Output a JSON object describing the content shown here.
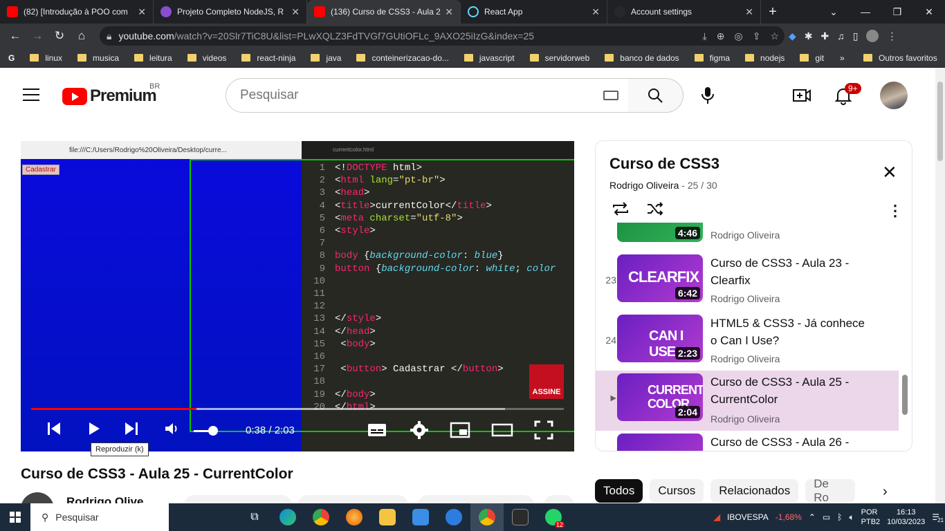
{
  "browser": {
    "tabs": [
      {
        "title": "(82) [Introdução à POO com",
        "icon_color": "#ff0000"
      },
      {
        "title": "Projeto Completo NodeJS, R",
        "icon_color": "#8a4dd0"
      },
      {
        "title": "(136) Curso de CSS3 - Aula 2",
        "icon_color": "#ff0000"
      },
      {
        "title": "React App",
        "icon_color": "#61dafb"
      },
      {
        "title": "Account settings",
        "icon_color": "#24292f"
      }
    ],
    "url_host": "youtube.com",
    "url_path": "/watch?v=20Slr7TiC8U&list=PLwXQLZ3FdTVGf7GUtiOFLc_9AXO25iIzG&index=25",
    "bookmarks": [
      "linux",
      "musica",
      "leitura",
      "videos",
      "react-ninja",
      "java",
      "conteinerizacao-do...",
      "javascript",
      "servidorweb",
      "banco de dados",
      "figma",
      "nodejs",
      "git"
    ],
    "bookmarks_more": "»",
    "other_bookmarks": "Outros favoritos"
  },
  "youtube": {
    "logo_text": "Premium",
    "region": "BR",
    "search_placeholder": "Pesquisar",
    "notifications_badge": "9+"
  },
  "player": {
    "browser_url": "file:///C:/Users/Rodrigo%20Oliveira/Desktop/curre...",
    "demo_button": "Cadastrar",
    "editor_tab": "currentcolor.html",
    "code_lines": [
      {
        "n": "1",
        "html": "<span class='pl'>&lt;!</span><span class='tg'>DOCTYPE</span><span class='pl'> html&gt;</span>"
      },
      {
        "n": "2",
        "html": "<span class='pl'>&lt;</span><span class='tg'>html</span> <span class='at'>lang</span><span class='pl'>=</span><span class='st'>\"pt-br\"</span><span class='pl'>&gt;</span>"
      },
      {
        "n": "3",
        "html": "<span class='pl'>&lt;</span><span class='tg'>head</span><span class='pl'>&gt;</span>"
      },
      {
        "n": "4",
        "html": "<span class='pl'>&lt;</span><span class='tg'>title</span><span class='pl'>&gt;currentColor&lt;/</span><span class='tg'>title</span><span class='pl'>&gt;</span>"
      },
      {
        "n": "5",
        "html": "<span class='pl'>&lt;</span><span class='tg'>meta</span> <span class='at'>charset</span><span class='pl'>=</span><span class='st'>\"utf-8\"</span><span class='pl'>&gt;</span>"
      },
      {
        "n": "6",
        "html": "<span class='pl'>&lt;</span><span class='tg'>style</span><span class='pl'>&gt;</span>"
      },
      {
        "n": "7",
        "html": ""
      },
      {
        "n": "8",
        "html": "<span class='tg'>body</span><span class='pl'> {</span><span class='it'>background-color</span><span class='pl'>: </span><span class='it'>blue</span><span class='pl'>}</span>"
      },
      {
        "n": "9",
        "html": "<span class='tg'>button</span><span class='pl'> {</span><span class='it'>background-color</span><span class='pl'>: </span><span class='it'>white</span><span class='pl'>; </span><span class='it'>color</span>"
      },
      {
        "n": "10",
        "html": ""
      },
      {
        "n": "11",
        "html": ""
      },
      {
        "n": "12",
        "html": ""
      },
      {
        "n": "13",
        "html": "<span class='pl'>&lt;/</span><span class='tg'>style</span><span class='pl'>&gt;</span>"
      },
      {
        "n": "14",
        "html": "<span class='pl'>&lt;/</span><span class='tg'>head</span><span class='pl'>&gt;</span>"
      },
      {
        "n": "15",
        "html": "<span class='pl'> &lt;</span><span class='tg'>body</span><span class='pl'>&gt;</span>"
      },
      {
        "n": "16",
        "html": ""
      },
      {
        "n": "17",
        "html": "<span class='pl'> &lt;</span><span class='tg'>button</span><span class='pl'>&gt; Cadastrar &lt;/</span><span class='tg'>button</span><span class='pl'>&gt;</span>"
      },
      {
        "n": "18",
        "html": ""
      },
      {
        "n": "19",
        "html": "<span class='pl'>&lt;/</span><span class='tg'>body</span><span class='pl'>&gt;</span>"
      },
      {
        "n": "20",
        "html": "<span class='pl'>&lt;/</span><span class='tg'>html</span><span class='pl'>&gt;</span>"
      }
    ],
    "subscribe_label": "ASSINE",
    "time": "0:38 / 2:03",
    "played_fraction": 0.31,
    "buffered_fraction": 0.89,
    "volume_fraction": 0.7,
    "tooltip": "Reproduzir (k)"
  },
  "video": {
    "title": "Curso de CSS3 - Aula 25 - CurrentColor",
    "channel": "Rodrigo Olive"
  },
  "playlist": {
    "title": "Curso de CSS3",
    "owner": "Rodrigo Oliveira",
    "position": "25 / 30",
    "items": [
      {
        "index": "",
        "title": "",
        "channel": "Rodrigo Oliveira",
        "duration": "4:46",
        "thumb_text": ""
      },
      {
        "index": "23",
        "title": "Curso de CSS3 - Aula 23 - Clearfix",
        "channel": "Rodrigo Oliveira",
        "duration": "6:42",
        "thumb_text": "CLEARFIX"
      },
      {
        "index": "24",
        "title": "HTML5 & CSS3 - Já conhece o Can I Use?",
        "channel": "Rodrigo Oliveira",
        "duration": "2:23",
        "thumb_text": "CAN I USE"
      },
      {
        "index": "▶",
        "title": "Curso de CSS3 - Aula 25 - CurrentColor",
        "channel": "Rodrigo Oliveira",
        "duration": "2:04",
        "thumb_text": "CURRENT COLOR"
      },
      {
        "index": "",
        "title": "Curso de CSS3 - Aula 26 -",
        "channel": "",
        "duration": "",
        "thumb_text": ""
      }
    ]
  },
  "chips": [
    "Todos",
    "Cursos",
    "Relacionados",
    "De Ro"
  ],
  "taskbar": {
    "search": "Pesquisar",
    "stock_name": "IBOVESPA",
    "stock_change": "-1,68%",
    "lang": "POR",
    "layout": "PTB2",
    "time": "16:13",
    "date": "10/03/2023",
    "notif_count": "21",
    "whatsapp_badge": "12"
  }
}
